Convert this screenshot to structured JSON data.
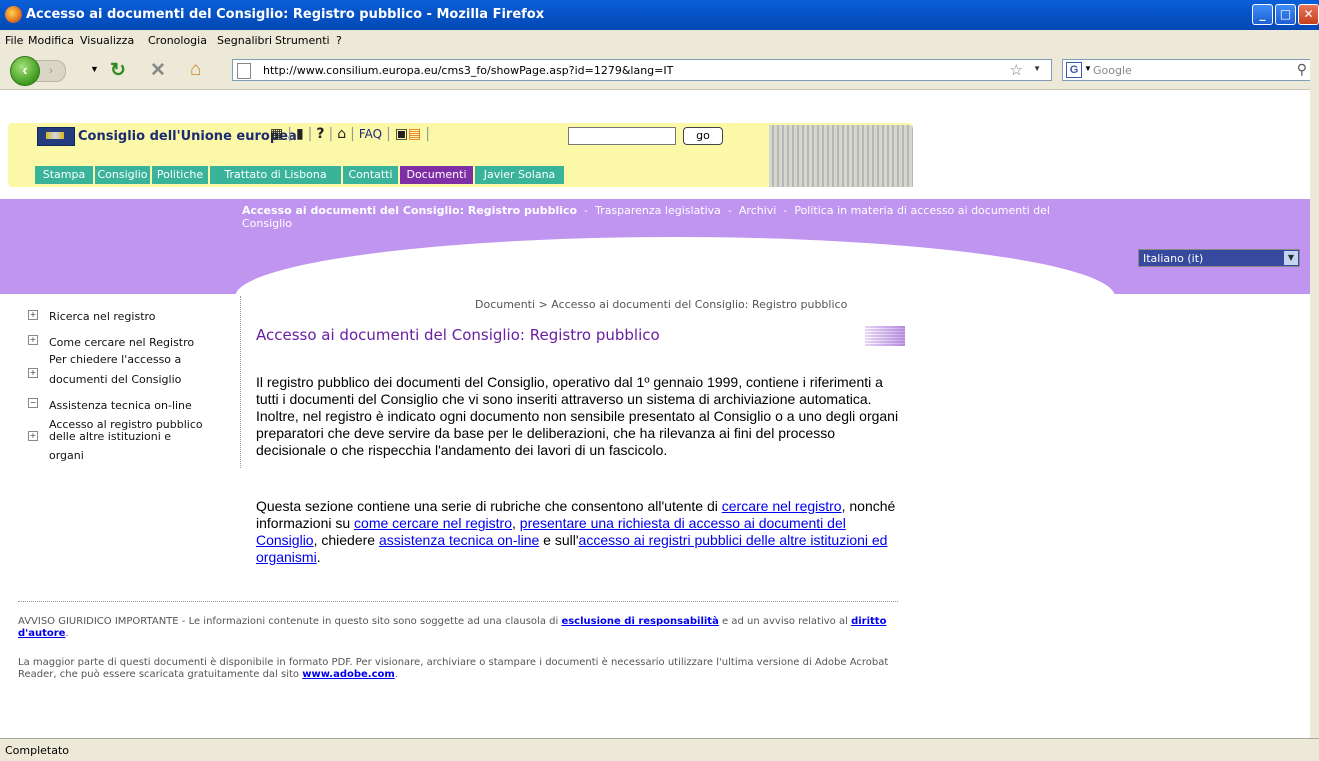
{
  "window": {
    "title": "Accesso ai documenti del Consiglio: Registro pubblico - Mozilla Firefox"
  },
  "menu": [
    "File",
    "Modifica",
    "Visualizza",
    "Cronologia",
    "Segnalibri",
    "Strumenti",
    "?"
  ],
  "nav": {
    "url": "http://www.consilium.europa.eu/cms3_fo/showPage.asp?id=1279&lang=IT",
    "search_placeholder": "Google"
  },
  "site": {
    "name": "Consiglio dell'Unione europea",
    "faq": "FAQ",
    "go": "go",
    "tabs": [
      "Stampa",
      "Consiglio",
      "Politiche",
      "Trattato di Lisbona",
      "Contatti",
      "Documenti",
      "Javier Solana"
    ],
    "active_tab": "Documenti",
    "band_links": {
      "current": "Accesso ai documenti del Consiglio: Registro pubblico",
      "l1": "Trasparenza legislativa",
      "l2": "Archivi",
      "l3": "Politica in materia di accesso ai documenti del Consiglio"
    },
    "language": "Italiano (it)"
  },
  "sidebar": [
    {
      "label": "Ricerca nel registro",
      "icon": "plus"
    },
    {
      "label": "Come cercare nel Registro",
      "icon": "plus"
    },
    {
      "line1": "Per chiedere l'accesso a",
      "line2": "documenti del Consiglio",
      "icon": "plus"
    },
    {
      "label": "Assistenza tecnica on-line",
      "icon": "minus"
    },
    {
      "line1": "Accesso al registro pubblico",
      "line2": "delle altre istituzioni e",
      "line3": "organi",
      "icon": "plus"
    }
  ],
  "main": {
    "breadcrumb": "Documenti > Accesso ai documenti del Consiglio: Registro pubblico",
    "title": "Accesso ai documenti del Consiglio: Registro pubblico",
    "p1": "Il registro pubblico dei documenti del Consiglio, operativo dal 1º gennaio 1999, contiene i riferimenti a tutti i documenti del Consiglio che vi sono inseriti attraverso un sistema di archiviazione automatica. Inoltre, nel registro è indicato ogni documento non sensibile presentato al Consiglio o a uno degli organi preparatori che deve servire da base per le deliberazioni, che ha rilevanza ai fini del processo decisionale o che rispecchia l'andamento dei lavori di un fascicolo.",
    "p2": {
      "t1": "Questa sezione contiene una serie di rubriche che consentono all'utente di ",
      "l1": "cercare nel registro",
      "t2": ", nonché informazioni su ",
      "l2": "come cercare nel registro",
      "t3": ", ",
      "l3": "presentare una richiesta di accesso ai documenti del Consiglio",
      "t4": ", chiedere ",
      "l4": "assistenza tecnica on-line",
      "t5": " e sull'",
      "l5": "accesso ai registri pubblici delle altre istituzioni ed organismi",
      "t6": "."
    }
  },
  "footer": {
    "f1": {
      "t1": "AVVISO GIURIDICO IMPORTANTE - Le informazioni contenute in questo sito sono soggette ad una clausola di ",
      "l1": "esclusione di responsabilità",
      "t2": " e ad un avviso relativo al ",
      "l2": "diritto d'autore",
      "t3": "."
    },
    "f2": {
      "t1": "La maggior parte di questi documenti è disponibile in formato PDF. Per visionare, archiviare o stampare i documenti è necessario utilizzare l'ultima versione di Adobe Acrobat Reader, che può essere scaricata gratuitamente dal sito ",
      "l1": "www.adobe.com",
      "t2": "."
    }
  },
  "status": "Completato",
  "colors": {
    "title_bar": "#0754c8",
    "band": "#bf95f0",
    "tab": "#39b49a",
    "tab_active": "#7f2fa6",
    "page_title": "#6a1fa1"
  }
}
